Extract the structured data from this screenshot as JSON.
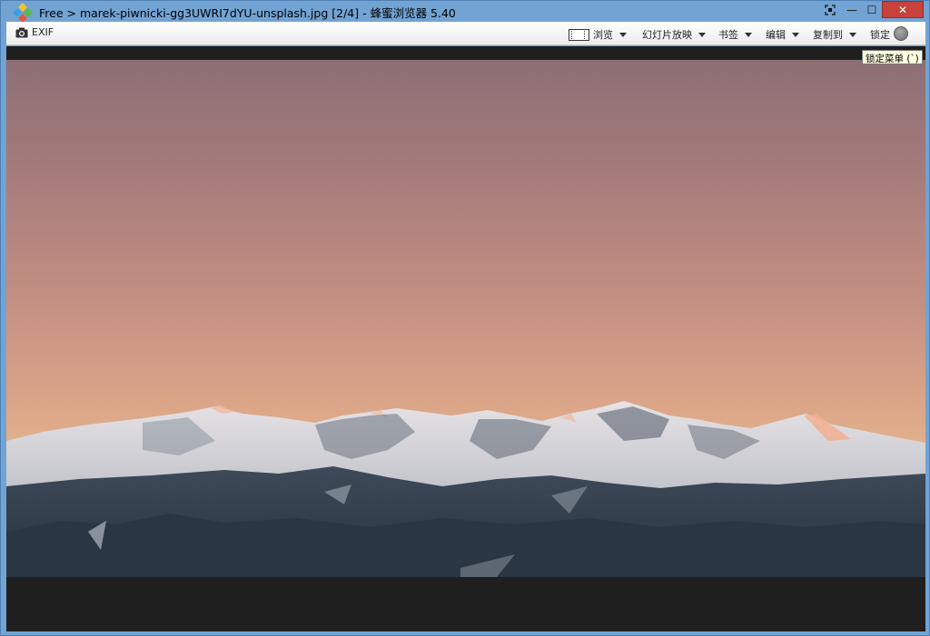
{
  "window": {
    "title": "Free > marek-piwnicki-gg3UWRI7dYU-unsplash.jpg [2/4] - 蜂蜜浏览器 5.40"
  },
  "window_controls": {
    "close_glyph": "✕",
    "minimize_glyph": "—",
    "maximize_glyph": "☐"
  },
  "toolbar": {
    "exif_label": "EXIF",
    "browse_label": "浏览",
    "slideshow_label": "幻灯片放映",
    "bookmark_label": "书签",
    "edit_label": "编辑",
    "copy_to_label": "复制到",
    "lock_label": "锁定"
  },
  "tooltip": {
    "text": "锁定菜单 (`)"
  },
  "colors": {
    "titlebar": "#71a3d3",
    "close_button": "#c7423b",
    "viewer_background": "#1f1f1f",
    "tooltip_background": "#ffffe1"
  }
}
